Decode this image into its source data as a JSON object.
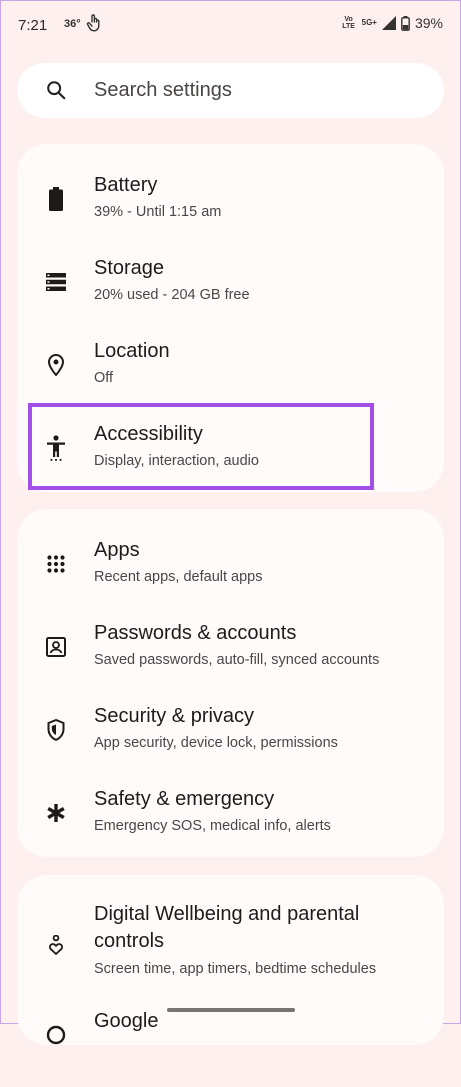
{
  "status_bar": {
    "time": "7:21",
    "temperature": "36°",
    "volte_label": "Vo LTE",
    "network": "5G+",
    "battery_percent": "39%"
  },
  "search": {
    "placeholder": "Search settings"
  },
  "groups": [
    {
      "items": [
        {
          "title": "Battery",
          "subtitle": "39% - Until 1:15 am",
          "icon": "battery-icon"
        },
        {
          "title": "Storage",
          "subtitle": "20% used - 204 GB free",
          "icon": "storage-icon"
        },
        {
          "title": "Location",
          "subtitle": "Off",
          "icon": "location-pin-icon"
        },
        {
          "title": "Accessibility",
          "subtitle": "Display, interaction, audio",
          "icon": "accessibility-icon",
          "highlighted": true
        }
      ]
    },
    {
      "items": [
        {
          "title": "Apps",
          "subtitle": "Recent apps, default apps",
          "icon": "apps-grid-icon"
        },
        {
          "title": "Passwords & accounts",
          "subtitle": "Saved passwords, auto-fill, synced accounts",
          "icon": "account-box-icon"
        },
        {
          "title": "Security & privacy",
          "subtitle": "App security, device lock, permissions",
          "icon": "shield-icon"
        },
        {
          "title": "Safety & emergency",
          "subtitle": "Emergency SOS, medical info, alerts",
          "icon": "asterisk-icon"
        }
      ]
    },
    {
      "items": [
        {
          "title_line1": "Digital Wellbeing and parental",
          "title_line2": "controls",
          "subtitle": "Screen time, app timers, bedtime schedules",
          "icon": "wellbeing-icon"
        },
        {
          "title": "Google",
          "icon": "google-icon"
        }
      ]
    }
  ],
  "colors": {
    "background": "#FDF0EE",
    "card": "#FFFBFB",
    "highlight": "#A24FE9"
  }
}
